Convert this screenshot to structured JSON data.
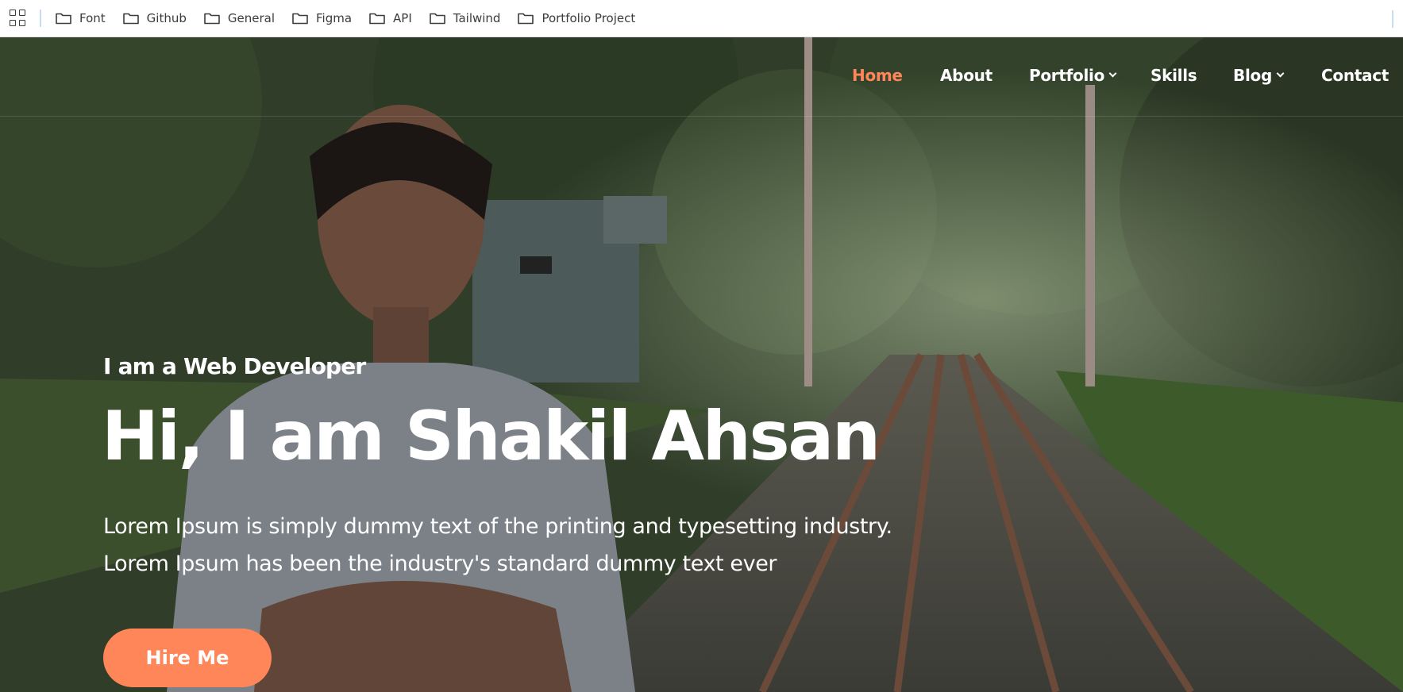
{
  "bookmarks": {
    "items": [
      {
        "label": "Font"
      },
      {
        "label": "Github"
      },
      {
        "label": "General"
      },
      {
        "label": "Figma"
      },
      {
        "label": "API"
      },
      {
        "label": "Tailwind"
      },
      {
        "label": "Portfolio Project"
      }
    ]
  },
  "nav": {
    "items": [
      {
        "label": "Home",
        "active": true,
        "dropdown": false
      },
      {
        "label": "About",
        "active": false,
        "dropdown": false
      },
      {
        "label": "Portfolio",
        "active": false,
        "dropdown": true
      },
      {
        "label": "Skills",
        "active": false,
        "dropdown": false
      },
      {
        "label": "Blog",
        "active": false,
        "dropdown": true
      },
      {
        "label": "Contact",
        "active": false,
        "dropdown": false
      }
    ]
  },
  "hero": {
    "tagline": "I am a Web Developer",
    "headline": "Hi, I am Shakil Ahsan",
    "description_line1": "Lorem Ipsum is simply dummy text of the printing and typesetting industry.",
    "description_line2": "Lorem Ipsum has been the industry's standard dummy text ever",
    "cta_label": "Hire Me",
    "background_image": "person-on-railway-tracks-photo"
  },
  "colors": {
    "accent": "#ff8659",
    "nav_text": "#ffffff",
    "bookmark_text": "#3c3c3c"
  }
}
